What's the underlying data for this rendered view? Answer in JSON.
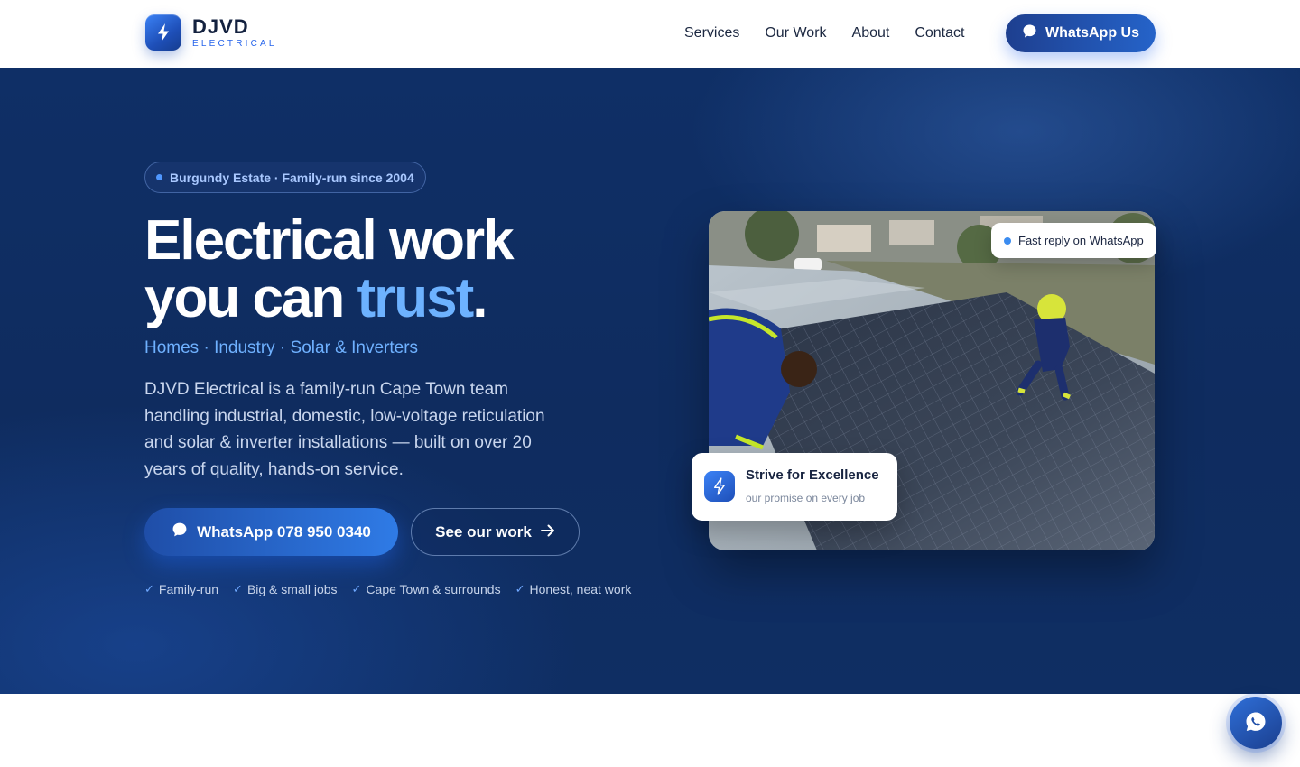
{
  "brand": {
    "name": "DJVD",
    "tagline": "ELECTRICAL",
    "logo_icon": "lightning-bolt-icon"
  },
  "nav": {
    "items": [
      "Services",
      "Our Work",
      "About",
      "Contact"
    ],
    "cta_label": "WhatsApp Us",
    "cta_icon": "chat-bubble-icon"
  },
  "hero": {
    "pill": "Burgundy Estate · Family-run since 2004",
    "headline_line1": "Electrical work",
    "headline_line2_prefix": "you can ",
    "headline_accent": "trust",
    "headline_suffix": ".",
    "subline": "Homes · Industry · Solar & Inverters",
    "description": "DJVD Electrical is a family-run Cape Town team handling industrial, domestic, low-voltage reticulation and solar & inverter installations — built on over 20 years of quality, hands-on service.",
    "primary_button": "WhatsApp 078 950 0340",
    "secondary_button": "See our work",
    "checks": [
      "Family-run",
      "Big & small jobs",
      "Cape Town & surrounds",
      "Honest, neat work"
    ]
  },
  "photo": {
    "badge": "Fast reply on WhatsApp",
    "card_title": "Strive for Excellence",
    "card_subtitle": "our promise on every job"
  },
  "colors": {
    "hero_bg": "#0f2c5f",
    "accent": "#6db2ff",
    "primary": "#2563eb"
  },
  "floating_button": {
    "icon": "whatsapp-icon"
  }
}
